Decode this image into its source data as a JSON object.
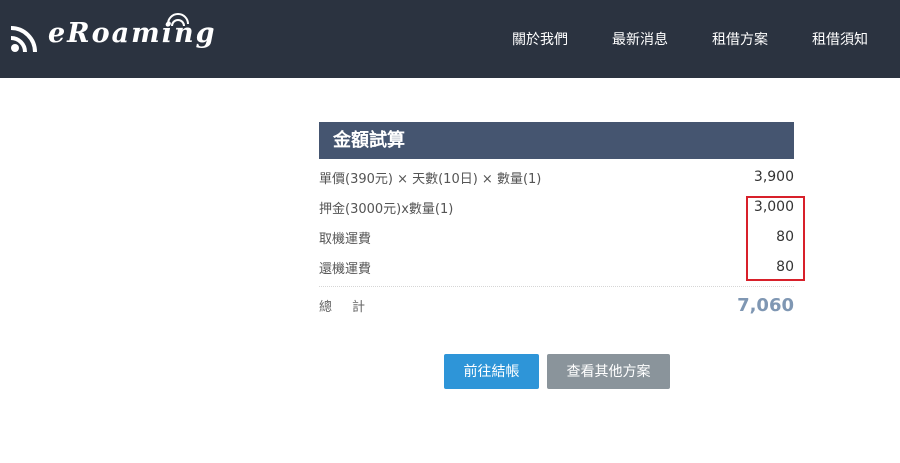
{
  "nav": {
    "logo_text": "eRoaming",
    "links": [
      {
        "label": "關於我們"
      },
      {
        "label": "最新消息"
      },
      {
        "label": "租借方案"
      },
      {
        "label": "租借須知"
      }
    ]
  },
  "calculator": {
    "title": "金額試算",
    "rows": [
      {
        "label": "單價(390元) × 天數(10日) × 數量(1)",
        "value": "3,900"
      },
      {
        "label": "押金(3000元)x數量(1)",
        "value": "3,000"
      },
      {
        "label": "取機運費",
        "value": "80"
      },
      {
        "label": "還機運費",
        "value": "80"
      }
    ],
    "total_label": "總計",
    "total_value": "7,060"
  },
  "buttons": {
    "checkout": "前往結帳",
    "other_plans": "查看其他方案"
  },
  "colors": {
    "navbar_bg": "#2b3340",
    "header_bg": "#455570",
    "primary": "#2e95d8",
    "secondary": "#8a949b",
    "highlight": "#d8202a",
    "total": "#7f97b3"
  }
}
